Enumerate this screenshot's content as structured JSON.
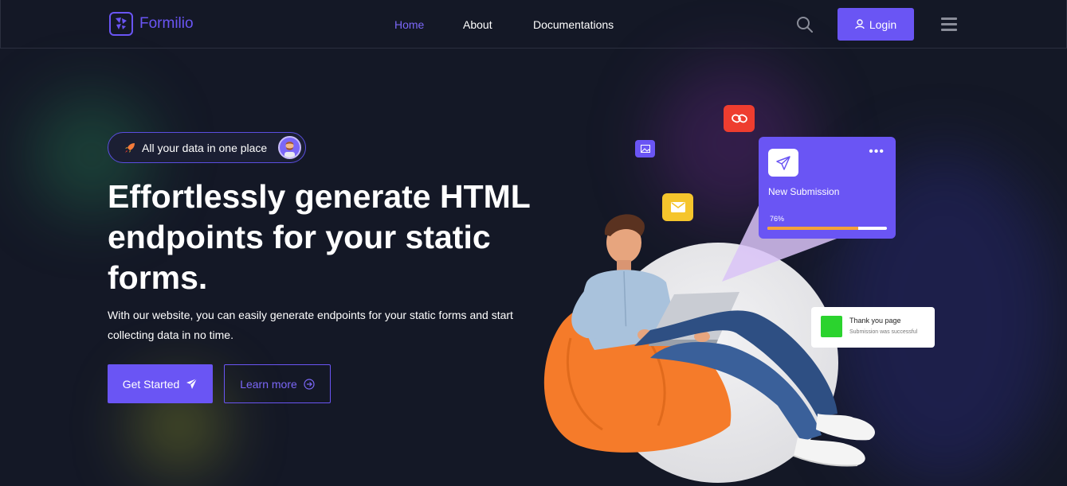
{
  "brand": {
    "name": "Formilio",
    "accent": "#6a55f4"
  },
  "nav": {
    "links": [
      {
        "label": "Home",
        "active": true
      },
      {
        "label": "About",
        "active": false
      },
      {
        "label": "Documentations",
        "active": false
      }
    ],
    "search_icon": "search-icon",
    "login_label": "Login",
    "menu_icon": "hamburger-icon"
  },
  "hero": {
    "badge_text": "All your data in one place",
    "title": "Effortlessly generate HTML endpoints for your static forms.",
    "description": "With our website, you can easily generate endpoints for your static forms and start collecting data in no time.",
    "primary_button": "Get Started",
    "secondary_button": "Learn more"
  },
  "illustration": {
    "submission_card": {
      "title": "New Submission",
      "progress_label": "76%",
      "progress": 0.76,
      "menu": "•••"
    },
    "thankyou_card": {
      "title": "Thank you page",
      "subtitle": "Submission was successful"
    },
    "colors": {
      "link_icon": "#ee3d2f",
      "mail_icon": "#f5c52c",
      "success": "#2bd32e",
      "progress": "#f5a23a"
    }
  }
}
